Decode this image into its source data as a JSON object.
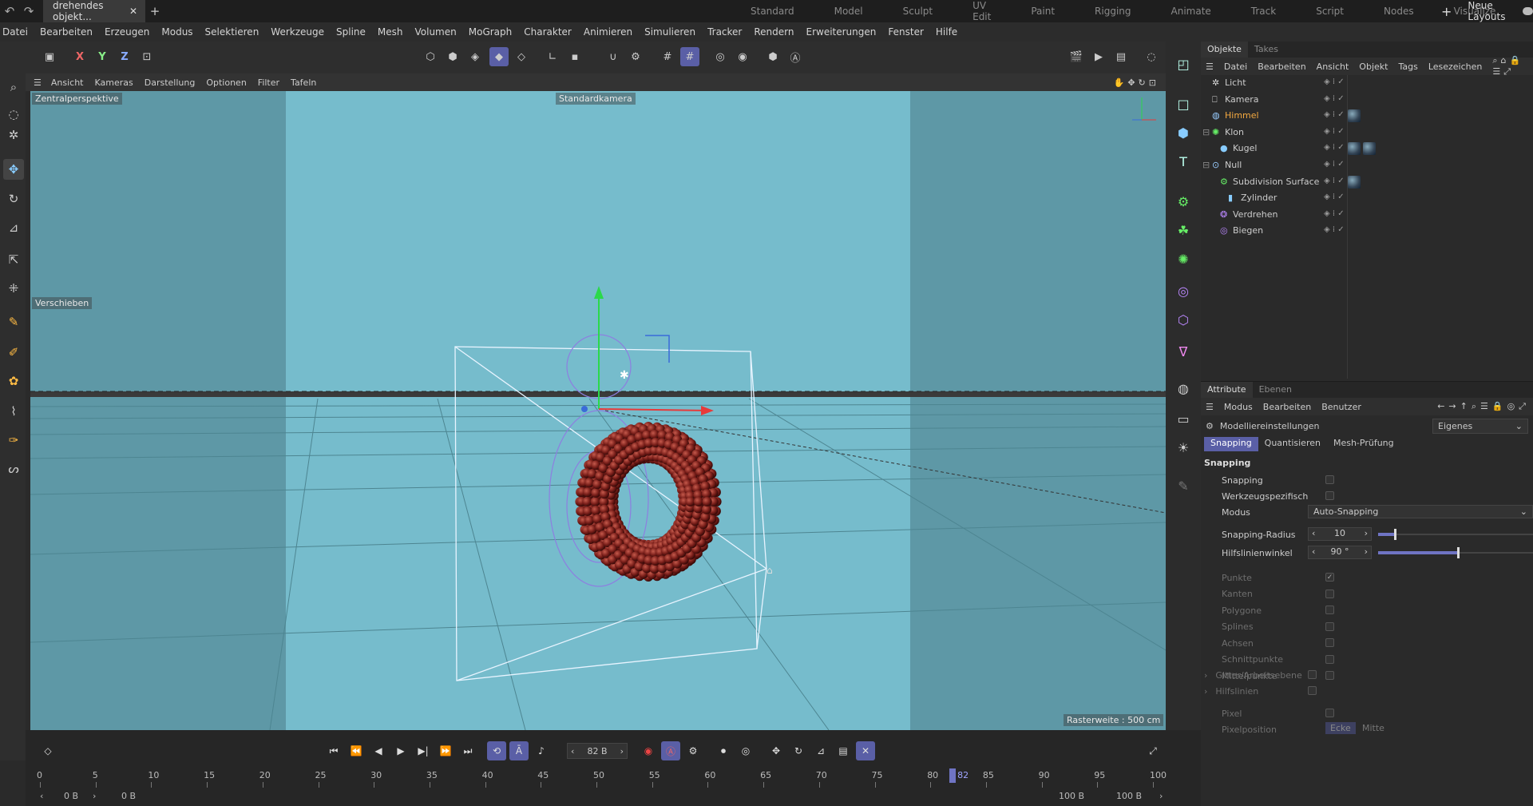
{
  "topbar": {
    "document_tab": "drehendes objekt...",
    "layouts": [
      "Standard",
      "Model",
      "Sculpt",
      "UV Edit",
      "Paint",
      "Rigging",
      "Animate",
      "Track",
      "Script",
      "Nodes",
      "Visualize"
    ],
    "new_layouts": "Neue Layouts"
  },
  "menubar": [
    "Datei",
    "Bearbeiten",
    "Erzeugen",
    "Modus",
    "Selektieren",
    "Werkzeuge",
    "Spline",
    "Mesh",
    "Volumen",
    "MoGraph",
    "Charakter",
    "Animieren",
    "Simulieren",
    "Tracker",
    "Rendern",
    "Erweiterungen",
    "Fenster",
    "Hilfe"
  ],
  "toolbar": {
    "axis_x": "X",
    "axis_y": "Y",
    "axis_z": "Z"
  },
  "viewport_menu": [
    "Ansicht",
    "Kameras",
    "Darstellung",
    "Optionen",
    "Filter",
    "Tafeln"
  ],
  "viewport": {
    "perspective_label": "Zentralperspektive",
    "camera_label": "Standardkamera",
    "tool_label": "Verschieben",
    "grid_info": "Rasterweite : 500 cm",
    "background_color": "#76bccc",
    "torus_color": "#7a1f1a"
  },
  "objects_panel": {
    "tabs": [
      "Objekte",
      "Takes"
    ],
    "menu": [
      "Datei",
      "Bearbeiten",
      "Ansicht",
      "Objekt",
      "Tags",
      "Lesezeichen"
    ],
    "items": [
      {
        "name": "Licht",
        "icon": "light-icon",
        "indent": 0
      },
      {
        "name": "Kamera",
        "icon": "camera-icon",
        "indent": 0
      },
      {
        "name": "Himmel",
        "icon": "sky-icon",
        "indent": 0,
        "highlight": true
      },
      {
        "name": "Klon",
        "icon": "cloner-icon",
        "indent": 0
      },
      {
        "name": "Kugel",
        "icon": "sphere-icon",
        "indent": 1
      },
      {
        "name": "Null",
        "icon": "null-icon",
        "indent": 0
      },
      {
        "name": "Subdivision Surface",
        "icon": "subdivision-icon",
        "indent": 1
      },
      {
        "name": "Zylinder",
        "icon": "cylinder-icon",
        "indent": 2
      },
      {
        "name": "Verdrehen",
        "icon": "twist-icon",
        "indent": 1
      },
      {
        "name": "Biegen",
        "icon": "bend-icon",
        "indent": 1
      }
    ]
  },
  "attributes_panel": {
    "tabs": [
      "Attribute",
      "Ebenen"
    ],
    "menu": [
      "Modus",
      "Bearbeiten",
      "Benutzer"
    ],
    "title": "Modelliereinstellungen",
    "preset": "Eigenes",
    "subtabs": [
      "Snapping",
      "Quantisieren",
      "Mesh-Prüfung"
    ],
    "section": "Snapping",
    "snapping_label": "Snapping",
    "tool_specific_label": "Werkzeugspezifisch",
    "mode_label": "Modus",
    "mode_value": "Auto-Snapping",
    "radius_label": "Snapping-Radius",
    "radius_value": "10",
    "radius_fraction": 0.1,
    "angle_label": "Hilfslinienwinkel",
    "angle_value": "90 °",
    "angle_fraction": 0.5,
    "snap_targets": [
      "Punkte",
      "Kanten",
      "Polygone",
      "Splines",
      "Achsen",
      "Schnittpunkte",
      "Mittelpunkte"
    ],
    "group_grid": "Gitter/Arbeitsebene",
    "group_guides": "Hilfslinien",
    "pixel_label": "Pixel",
    "pixel_position_label": "Pixelposition",
    "corner_label": "Ecke",
    "center_label": "Mitte"
  },
  "timeline": {
    "current_frame": "82 B",
    "ruler": [
      0,
      5,
      10,
      15,
      20,
      25,
      30,
      35,
      40,
      45,
      50,
      55,
      60,
      65,
      70,
      75,
      80,
      85,
      90,
      95,
      100
    ],
    "marker_label": "82",
    "start": "0 B",
    "start2": "0 B",
    "end": "100 B",
    "end2": "100 B"
  }
}
